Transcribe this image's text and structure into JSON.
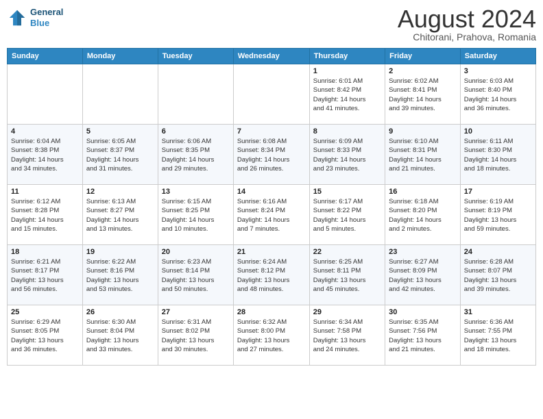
{
  "header": {
    "logo": {
      "general": "General",
      "blue": "Blue"
    },
    "title": "August 2024",
    "location": "Chitorani, Prahova, Romania"
  },
  "days_of_week": [
    "Sunday",
    "Monday",
    "Tuesday",
    "Wednesday",
    "Thursday",
    "Friday",
    "Saturday"
  ],
  "weeks": [
    [
      {
        "day": "",
        "info": ""
      },
      {
        "day": "",
        "info": ""
      },
      {
        "day": "",
        "info": ""
      },
      {
        "day": "",
        "info": ""
      },
      {
        "day": "1",
        "info": "Sunrise: 6:01 AM\nSunset: 8:42 PM\nDaylight: 14 hours\nand 41 minutes."
      },
      {
        "day": "2",
        "info": "Sunrise: 6:02 AM\nSunset: 8:41 PM\nDaylight: 14 hours\nand 39 minutes."
      },
      {
        "day": "3",
        "info": "Sunrise: 6:03 AM\nSunset: 8:40 PM\nDaylight: 14 hours\nand 36 minutes."
      }
    ],
    [
      {
        "day": "4",
        "info": "Sunrise: 6:04 AM\nSunset: 8:38 PM\nDaylight: 14 hours\nand 34 minutes."
      },
      {
        "day": "5",
        "info": "Sunrise: 6:05 AM\nSunset: 8:37 PM\nDaylight: 14 hours\nand 31 minutes."
      },
      {
        "day": "6",
        "info": "Sunrise: 6:06 AM\nSunset: 8:35 PM\nDaylight: 14 hours\nand 29 minutes."
      },
      {
        "day": "7",
        "info": "Sunrise: 6:08 AM\nSunset: 8:34 PM\nDaylight: 14 hours\nand 26 minutes."
      },
      {
        "day": "8",
        "info": "Sunrise: 6:09 AM\nSunset: 8:33 PM\nDaylight: 14 hours\nand 23 minutes."
      },
      {
        "day": "9",
        "info": "Sunrise: 6:10 AM\nSunset: 8:31 PM\nDaylight: 14 hours\nand 21 minutes."
      },
      {
        "day": "10",
        "info": "Sunrise: 6:11 AM\nSunset: 8:30 PM\nDaylight: 14 hours\nand 18 minutes."
      }
    ],
    [
      {
        "day": "11",
        "info": "Sunrise: 6:12 AM\nSunset: 8:28 PM\nDaylight: 14 hours\nand 15 minutes."
      },
      {
        "day": "12",
        "info": "Sunrise: 6:13 AM\nSunset: 8:27 PM\nDaylight: 14 hours\nand 13 minutes."
      },
      {
        "day": "13",
        "info": "Sunrise: 6:15 AM\nSunset: 8:25 PM\nDaylight: 14 hours\nand 10 minutes."
      },
      {
        "day": "14",
        "info": "Sunrise: 6:16 AM\nSunset: 8:24 PM\nDaylight: 14 hours\nand 7 minutes."
      },
      {
        "day": "15",
        "info": "Sunrise: 6:17 AM\nSunset: 8:22 PM\nDaylight: 14 hours\nand 5 minutes."
      },
      {
        "day": "16",
        "info": "Sunrise: 6:18 AM\nSunset: 8:20 PM\nDaylight: 14 hours\nand 2 minutes."
      },
      {
        "day": "17",
        "info": "Sunrise: 6:19 AM\nSunset: 8:19 PM\nDaylight: 13 hours\nand 59 minutes."
      }
    ],
    [
      {
        "day": "18",
        "info": "Sunrise: 6:21 AM\nSunset: 8:17 PM\nDaylight: 13 hours\nand 56 minutes."
      },
      {
        "day": "19",
        "info": "Sunrise: 6:22 AM\nSunset: 8:16 PM\nDaylight: 13 hours\nand 53 minutes."
      },
      {
        "day": "20",
        "info": "Sunrise: 6:23 AM\nSunset: 8:14 PM\nDaylight: 13 hours\nand 50 minutes."
      },
      {
        "day": "21",
        "info": "Sunrise: 6:24 AM\nSunset: 8:12 PM\nDaylight: 13 hours\nand 48 minutes."
      },
      {
        "day": "22",
        "info": "Sunrise: 6:25 AM\nSunset: 8:11 PM\nDaylight: 13 hours\nand 45 minutes."
      },
      {
        "day": "23",
        "info": "Sunrise: 6:27 AM\nSunset: 8:09 PM\nDaylight: 13 hours\nand 42 minutes."
      },
      {
        "day": "24",
        "info": "Sunrise: 6:28 AM\nSunset: 8:07 PM\nDaylight: 13 hours\nand 39 minutes."
      }
    ],
    [
      {
        "day": "25",
        "info": "Sunrise: 6:29 AM\nSunset: 8:05 PM\nDaylight: 13 hours\nand 36 minutes."
      },
      {
        "day": "26",
        "info": "Sunrise: 6:30 AM\nSunset: 8:04 PM\nDaylight: 13 hours\nand 33 minutes."
      },
      {
        "day": "27",
        "info": "Sunrise: 6:31 AM\nSunset: 8:02 PM\nDaylight: 13 hours\nand 30 minutes."
      },
      {
        "day": "28",
        "info": "Sunrise: 6:32 AM\nSunset: 8:00 PM\nDaylight: 13 hours\nand 27 minutes."
      },
      {
        "day": "29",
        "info": "Sunrise: 6:34 AM\nSunset: 7:58 PM\nDaylight: 13 hours\nand 24 minutes."
      },
      {
        "day": "30",
        "info": "Sunrise: 6:35 AM\nSunset: 7:56 PM\nDaylight: 13 hours\nand 21 minutes."
      },
      {
        "day": "31",
        "info": "Sunrise: 6:36 AM\nSunset: 7:55 PM\nDaylight: 13 hours\nand 18 minutes."
      }
    ]
  ]
}
